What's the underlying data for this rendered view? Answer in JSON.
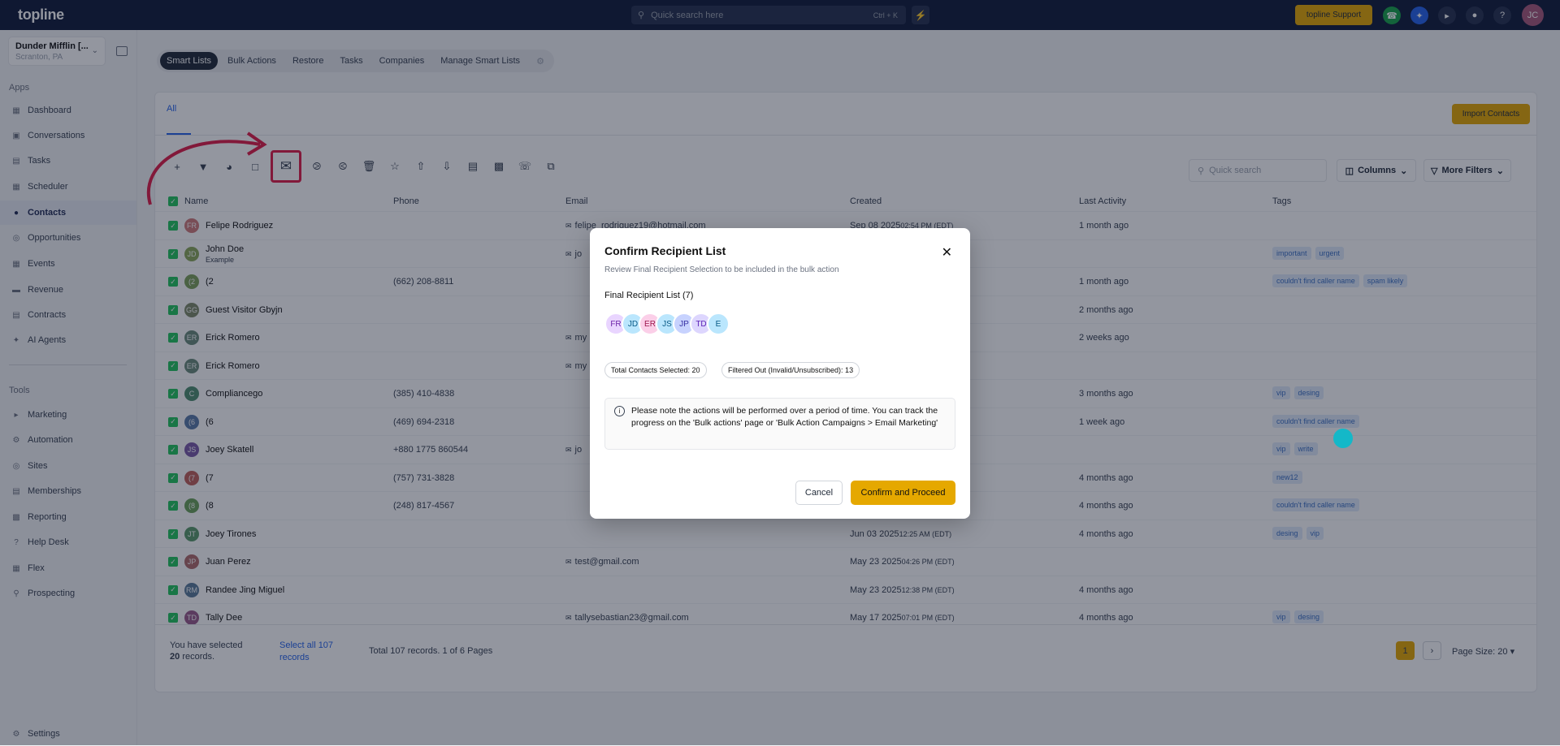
{
  "topbar": {
    "logo": "topline",
    "search_placeholder": "Quick search here",
    "search_shortcut": "Ctrl + K",
    "support_label": "topline Support",
    "avatar_initials": "JC"
  },
  "location": {
    "name": "Dunder Mifflin [...",
    "sub": "Scranton, PA"
  },
  "sidebar": {
    "apps_label": "Apps",
    "apps": [
      "Dashboard",
      "Conversations",
      "Tasks",
      "Scheduler",
      "Contacts",
      "Opportunities",
      "Events",
      "Revenue",
      "Contracts",
      "AI Agents"
    ],
    "tools_label": "Tools",
    "tools": [
      "Marketing",
      "Automation",
      "Sites",
      "Memberships",
      "Reporting",
      "Help Desk",
      "Flex",
      "Prospecting"
    ],
    "settings": "Settings"
  },
  "tabs": [
    "Smart Lists",
    "Bulk Actions",
    "Restore",
    "Tasks",
    "Companies",
    "Manage Smart Lists"
  ],
  "panel": {
    "all_tab": "All",
    "import_label": "Import Contacts",
    "quick_search": "Quick search",
    "columns_label": "Columns",
    "more_filters": "More Filters"
  },
  "table": {
    "headers": [
      "Name",
      "Phone",
      "Email",
      "Created",
      "Last Activity",
      "Tags"
    ],
    "rows": [
      {
        "initials": "FR",
        "color": "#d07a7a",
        "name": "Felipe Rodriguez",
        "sub": "",
        "phone": "",
        "email": "felipe_rodriguez19@hotmail.com",
        "created": "Sep 08 2025",
        "created_time": "02:54 PM (EDT)",
        "activity": "1 month ago",
        "tags": []
      },
      {
        "initials": "JD",
        "color": "#8aa85a",
        "name": "John Doe",
        "sub": "Example",
        "phone": "",
        "email": "jo",
        "created": "",
        "created_time": "",
        "activity": "",
        "tags": [
          "important",
          "urgent"
        ]
      },
      {
        "initials": "(2",
        "color": "#7ca05a",
        "name": "(2",
        "sub": "",
        "phone": "(662) 208-8811",
        "email": "",
        "created": "",
        "created_time": "",
        "activity": "1 month ago",
        "tags": [
          "couldn't find caller name",
          "spam likely"
        ]
      },
      {
        "initials": "GG",
        "color": "#7f8b6a",
        "name": "Guest Visitor Gbyjn",
        "sub": "",
        "phone": "",
        "email": "",
        "created": "",
        "created_time": "",
        "activity": "2 months ago",
        "tags": []
      },
      {
        "initials": "ER",
        "color": "#6a8a7a",
        "name": "Erick Romero",
        "sub": "",
        "phone": "",
        "email": "my",
        "created": "",
        "created_time": "",
        "activity": "2 weeks ago",
        "tags": []
      },
      {
        "initials": "ER",
        "color": "#6a8a7a",
        "name": "Erick Romero",
        "sub": "",
        "phone": "",
        "email": "my",
        "created": "",
        "created_time": "",
        "activity": "",
        "tags": []
      },
      {
        "initials": "C",
        "color": "#4f8f6f",
        "name": "Compliancego",
        "sub": "",
        "phone": "(385) 410-4838",
        "email": "",
        "created": "",
        "created_time": "",
        "activity": "3 months ago",
        "tags": [
          "vip",
          "desing"
        ]
      },
      {
        "initials": "(6",
        "color": "#5a7aa8",
        "name": "(6",
        "sub": "",
        "phone": "(469) 694-2318",
        "email": "",
        "created": "",
        "created_time": "",
        "activity": "1 week ago",
        "tags": [
          "couldn't find caller name"
        ]
      },
      {
        "initials": "JS",
        "color": "#7a5aa8",
        "name": "Joey Skatell",
        "sub": "",
        "phone": "+880 1775 860544",
        "email": "jo",
        "created": "",
        "created_time": "",
        "activity": "",
        "tags": [
          "vip",
          "write"
        ]
      },
      {
        "initials": "(7",
        "color": "#c0605a",
        "name": "(7",
        "sub": "",
        "phone": "(757) 731-3828",
        "email": "",
        "created": "",
        "created_time": "",
        "activity": "4 months ago",
        "tags": [
          "new12"
        ]
      },
      {
        "initials": "(8",
        "color": "#6aa05a",
        "name": "(8",
        "sub": "",
        "phone": "(248) 817-4567",
        "email": "",
        "created": "",
        "created_time": "",
        "activity": "4 months ago",
        "tags": [
          "couldn't find caller name"
        ]
      },
      {
        "initials": "JT",
        "color": "#5a9a6a",
        "name": "Joey Tirones",
        "sub": "",
        "phone": "",
        "email": "",
        "created": "Jun 03 2025",
        "created_time": "12:25 AM (EDT)",
        "activity": "4 months ago",
        "tags": [
          "desing",
          "vip"
        ]
      },
      {
        "initials": "JP",
        "color": "#b06a6a",
        "name": "Juan Perez",
        "sub": "",
        "phone": "",
        "email": "test@gmail.com",
        "created": "May 23 2025",
        "created_time": "04:26 PM (EDT)",
        "activity": "",
        "tags": []
      },
      {
        "initials": "RM",
        "color": "#5a7a9a",
        "name": "Randee Jing Miguel",
        "sub": "",
        "phone": "",
        "email": "",
        "created": "May 23 2025",
        "created_time": "12:38 PM (EDT)",
        "activity": "4 months ago",
        "tags": []
      },
      {
        "initials": "TD",
        "color": "#9a5a8a",
        "name": "Tally Dee",
        "sub": "",
        "phone": "",
        "email": "tallysebastian23@gmail.com",
        "created": "May 17 2025",
        "created_time": "07:01 PM (EDT)",
        "activity": "4 months ago",
        "tags": [
          "vip",
          "desing"
        ]
      }
    ]
  },
  "footer": {
    "selected_text": "You have selected",
    "selected_count": "20",
    "records_word": "records.",
    "select_all": "Select all 107 records",
    "total": "Total 107 records. 1 of 6 Pages",
    "page": "1",
    "page_size": "Page Size: 20"
  },
  "modal": {
    "title": "Confirm Recipient List",
    "subtitle": "Review Final Recipient Selection to be included in the bulk action",
    "final_label": "Final Recipient List (7)",
    "avatars": [
      {
        "initials": "FR",
        "bg": "#e9d5ff",
        "fg": "#6b21a8"
      },
      {
        "initials": "JD",
        "bg": "#bae6fd",
        "fg": "#075985"
      },
      {
        "initials": "ER",
        "bg": "#fbcfe8",
        "fg": "#9d174d"
      },
      {
        "initials": "JS",
        "bg": "#bae6fd",
        "fg": "#075985"
      },
      {
        "initials": "JP",
        "bg": "#c7d2fe",
        "fg": "#3730a3"
      },
      {
        "initials": "TD",
        "bg": "#ddd6fe",
        "fg": "#5b21b6"
      },
      {
        "initials": "E",
        "bg": "#bae6fd",
        "fg": "#075985"
      }
    ],
    "total_selected": "Total Contacts Selected: 20",
    "filtered_out": "Filtered Out (Invalid/Unsubscribed): 13",
    "note": "Please note the actions will be performed over a period of time. You can track the progress on the 'Bulk actions' page or 'Bulk Action Campaigns > Email Marketing'",
    "cancel": "Cancel",
    "confirm": "Confirm and Proceed"
  },
  "colors": {
    "accent": "#e5a800",
    "brand": "#0f1a3a",
    "highlight": "#e11d48"
  }
}
